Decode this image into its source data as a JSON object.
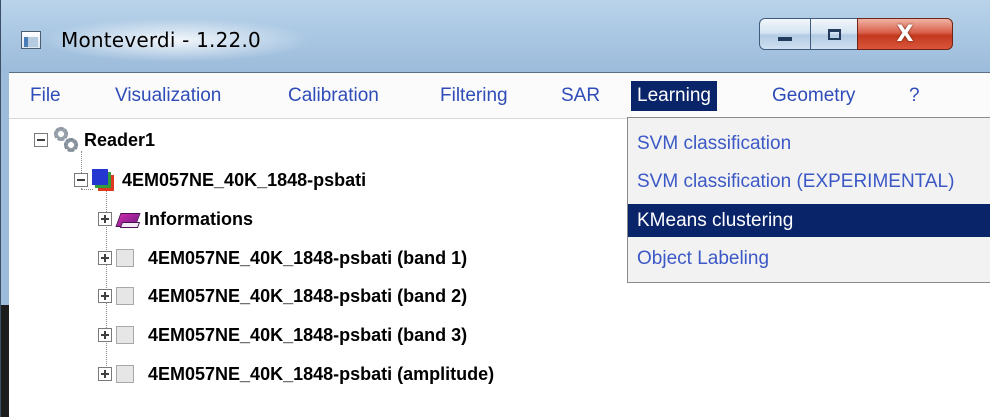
{
  "window": {
    "title": "Monteverdi - 1.22.0",
    "close_glyph": "X"
  },
  "menubar": {
    "items": [
      {
        "label": "File"
      },
      {
        "label": "Visualization"
      },
      {
        "label": "Calibration"
      },
      {
        "label": "Filtering"
      },
      {
        "label": "SAR"
      },
      {
        "label": "Learning",
        "active": true
      },
      {
        "label": "Geometry"
      },
      {
        "label": "?"
      }
    ]
  },
  "learning_menu": {
    "items": [
      {
        "label": "SVM classification"
      },
      {
        "label": "SVM classification (EXPERIMENTAL)"
      },
      {
        "label": "KMeans clustering",
        "selected": true
      },
      {
        "label": "Object Labeling"
      }
    ]
  },
  "tree": {
    "reader": {
      "label": "Reader1",
      "icon": "gears-icon",
      "expanded": true
    },
    "image": {
      "label": "4EM057NE_40K_1848-psbati",
      "icon": "layers-icon",
      "expanded": true
    },
    "children": [
      {
        "label": "Informations",
        "icon": "book-icon"
      },
      {
        "label": "4EM057NE_40K_1848-psbati (band 1)",
        "icon": "band-icon"
      },
      {
        "label": "4EM057NE_40K_1848-psbati (band 2)",
        "icon": "band-icon"
      },
      {
        "label": "4EM057NE_40K_1848-psbati (band 3)",
        "icon": "band-icon"
      },
      {
        "label": "4EM057NE_40K_1848-psbati (amplitude)",
        "icon": "band-icon"
      }
    ]
  },
  "colors": {
    "menu_text": "#2f4cb8",
    "highlight": "#0a246a",
    "dropdown_text": "#3b58c6"
  }
}
